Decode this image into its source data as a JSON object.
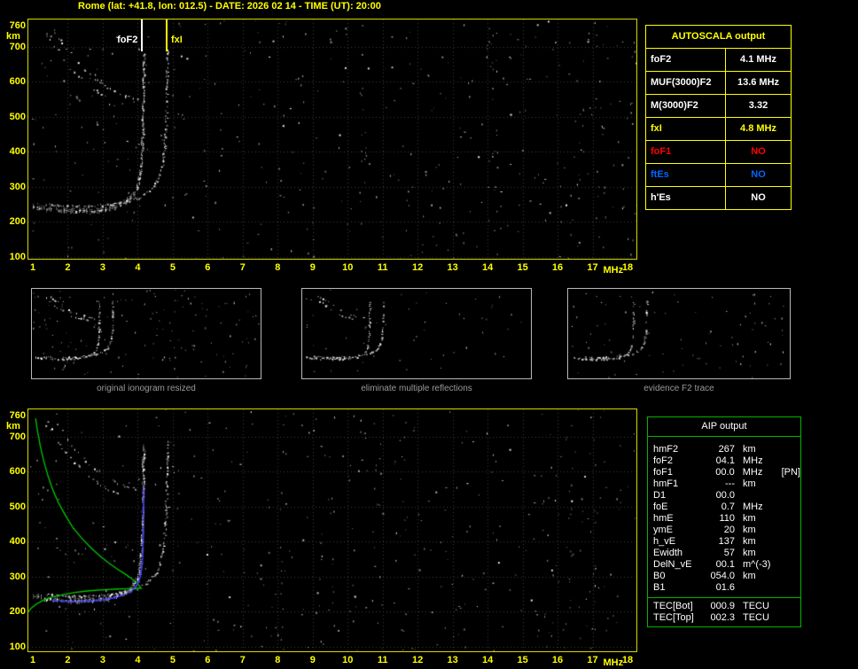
{
  "title": "Rome (lat: +41.8, lon: 012.5) - DATE: 2026 02 14 - TIME (UT): 20:00",
  "ionogram": {
    "x_ticks": [
      "1",
      "2",
      "3",
      "4",
      "5",
      "6",
      "7",
      "8",
      "9",
      "10",
      "11",
      "12",
      "13",
      "14",
      "15",
      "16",
      "17",
      "18"
    ],
    "x_unit": "MHz",
    "y_ticks": [
      "760",
      "700",
      "600",
      "500",
      "400",
      "300",
      "200",
      "100"
    ],
    "y_unit": "km",
    "markers": [
      {
        "label": "foF2",
        "mhz": 4.1,
        "color": "#ffffff"
      },
      {
        "label": "fxI",
        "mhz": 4.8,
        "color": "#ffff00"
      }
    ]
  },
  "autoscala_table": {
    "title": "AUTOSCALA output",
    "rows": [
      {
        "label": "foF2",
        "value": "4.1 MHz",
        "color": "#ffffff"
      },
      {
        "label": "MUF(3000)F2",
        "value": "13.6 MHz",
        "color": "#ffffff"
      },
      {
        "label": "M(3000)F2",
        "value": "3.32",
        "color": "#ffffff"
      },
      {
        "label": "fxI",
        "value": "4.8 MHz",
        "color": "#ffff00"
      },
      {
        "label": "foF1",
        "value": "NO",
        "color": "#ff0000"
      },
      {
        "label": "ftEs",
        "value": "NO",
        "color": "#0066ff"
      },
      {
        "label": "h'Es",
        "value": "NO",
        "color": "#ffffff"
      }
    ]
  },
  "thumbnails": [
    {
      "caption": "original ionogram resized"
    },
    {
      "caption": "eliminate multiple reflections"
    },
    {
      "caption": "evidence F2 trace"
    }
  ],
  "aip_table": {
    "title": "AIP output",
    "rows": [
      {
        "label": "hmF2",
        "value": "267",
        "unit": "km",
        "note": ""
      },
      {
        "label": "foF2",
        "value": "04.1",
        "unit": "MHz",
        "note": ""
      },
      {
        "label": "foF1",
        "value": "00.0",
        "unit": "MHz",
        "note": "[PN]"
      },
      {
        "label": "hmF1",
        "value": "---",
        "unit": "km",
        "note": ""
      },
      {
        "label": "D1",
        "value": "00.0",
        "unit": "",
        "note": ""
      },
      {
        "label": "foE",
        "value": "0.7",
        "unit": "MHz",
        "note": ""
      },
      {
        "label": "hmE",
        "value": "110",
        "unit": "km",
        "note": ""
      },
      {
        "label": "ymE",
        "value": "20",
        "unit": "km",
        "note": ""
      },
      {
        "label": "h_vE",
        "value": "137",
        "unit": "km",
        "note": ""
      },
      {
        "label": "Ewidth",
        "value": "57",
        "unit": "km",
        "note": ""
      },
      {
        "label": "DelN_vE",
        "value": "00.1",
        "unit": "m^(-3)",
        "note": ""
      },
      {
        "label": "B0",
        "value": "054.0",
        "unit": "km",
        "note": ""
      },
      {
        "label": "B1",
        "value": "01.6",
        "unit": "",
        "note": ""
      }
    ],
    "tec_rows": [
      {
        "label": "TEC[Bot]",
        "value": "000.9",
        "unit": "TECU"
      },
      {
        "label": "TEC[Top]",
        "value": "002.3",
        "unit": "TECU"
      }
    ]
  },
  "chart_data": [
    {
      "type": "scatter",
      "title": "Ionogram with AUTOSCALA scaled characteristics",
      "xlabel": "MHz",
      "ylabel": "km",
      "xlim": [
        1,
        18
      ],
      "ylim": [
        100,
        760
      ],
      "annotations": [
        {
          "label": "foF2",
          "x_mhz": 4.1
        },
        {
          "label": "fxI",
          "x_mhz": 4.8
        }
      ],
      "series": [
        {
          "name": "F2 ordinary trace",
          "color": "#ffffff",
          "points": [
            [
              1.0,
              248
            ],
            [
              1.15,
              244
            ],
            [
              1.3,
              241
            ],
            [
              1.5,
              238
            ],
            [
              1.7,
              236
            ],
            [
              1.9,
              234
            ],
            [
              2.1,
              233
            ],
            [
              2.3,
              233
            ],
            [
              2.5,
              233
            ],
            [
              2.7,
              234
            ],
            [
              2.9,
              236
            ],
            [
              3.1,
              239
            ],
            [
              3.3,
              244
            ],
            [
              3.5,
              251
            ],
            [
              3.65,
              259
            ],
            [
              3.8,
              270
            ],
            [
              3.9,
              283
            ],
            [
              3.97,
              297
            ],
            [
              4.02,
              315
            ],
            [
              4.06,
              338
            ],
            [
              4.09,
              368
            ],
            [
              4.11,
              405
            ],
            [
              4.13,
              455
            ],
            [
              4.14,
              520
            ],
            [
              4.15,
              600
            ],
            [
              4.16,
              680
            ]
          ]
        },
        {
          "name": "F2 extraordinary trace",
          "color": "#ffffff",
          "points": [
            [
              1.4,
              252
            ],
            [
              1.7,
              249
            ],
            [
              2.0,
              247
            ],
            [
              2.3,
              246
            ],
            [
              2.6,
              246
            ],
            [
              2.9,
              248
            ],
            [
              3.2,
              251
            ],
            [
              3.5,
              256
            ],
            [
              3.8,
              263
            ],
            [
              4.0,
              270
            ],
            [
              4.2,
              280
            ],
            [
              4.35,
              292
            ],
            [
              4.5,
              310
            ],
            [
              4.6,
              332
            ],
            [
              4.68,
              360
            ],
            [
              4.74,
              398
            ],
            [
              4.78,
              448
            ],
            [
              4.81,
              515
            ],
            [
              4.83,
              600
            ],
            [
              4.84,
              690
            ]
          ]
        },
        {
          "name": "low-frequency retardation arc 1",
          "color": "#ffffff",
          "points": [
            [
              1.35,
              750
            ],
            [
              1.5,
              722
            ],
            [
              1.7,
              690
            ],
            [
              1.95,
              655
            ],
            [
              2.2,
              625
            ],
            [
              2.5,
              597
            ],
            [
              2.8,
              574
            ],
            [
              3.1,
              556
            ],
            [
              3.4,
              543
            ],
            [
              3.7,
              535
            ]
          ]
        },
        {
          "name": "low-frequency retardation arc 2",
          "color": "#ffffff",
          "points": [
            [
              1.6,
              752
            ],
            [
              1.75,
              726
            ],
            [
              1.95,
              696
            ],
            [
              2.2,
              664
            ],
            [
              2.45,
              636
            ],
            [
              2.75,
              610
            ],
            [
              3.05,
              589
            ],
            [
              3.35,
              572
            ],
            [
              3.65,
              560
            ],
            [
              3.95,
              552
            ]
          ]
        }
      ]
    },
    {
      "type": "scatter",
      "title": "Ionogram with AIP restored electron density profile",
      "xlabel": "MHz",
      "ylabel": "km",
      "xlim": [
        1,
        18
      ],
      "ylim": [
        100,
        760
      ],
      "series": [
        {
          "name": "electron density profile (plasma frequency vs height)",
          "color": "#00c800",
          "points": [
            [
              0.87,
              200
            ],
            [
              0.95,
              210
            ],
            [
              1.1,
              222
            ],
            [
              1.3,
              233
            ],
            [
              1.55,
              242
            ],
            [
              1.85,
              249
            ],
            [
              2.2,
              255
            ],
            [
              2.6,
              260
            ],
            [
              3.0,
              263
            ],
            [
              3.4,
              265
            ],
            [
              3.75,
              266
            ],
            [
              4.1,
              267
            ],
            [
              4.0,
              280
            ],
            [
              3.85,
              293
            ],
            [
              3.65,
              307
            ],
            [
              3.4,
              323
            ],
            [
              3.15,
              341
            ],
            [
              2.9,
              361
            ],
            [
              2.65,
              384
            ],
            [
              2.4,
              410
            ],
            [
              2.15,
              440
            ],
            [
              1.95,
              472
            ],
            [
              1.75,
              508
            ],
            [
              1.58,
              546
            ],
            [
              1.44,
              586
            ],
            [
              1.32,
              628
            ],
            [
              1.22,
              670
            ],
            [
              1.14,
              712
            ],
            [
              1.08,
              752
            ]
          ]
        },
        {
          "name": "fitted ordinary trace",
          "color": "#4a4aff",
          "points": [
            [
              1.55,
              234
            ],
            [
              1.8,
              233
            ],
            [
              2.05,
              232
            ],
            [
              2.3,
              232
            ],
            [
              2.55,
              233
            ],
            [
              2.8,
              235
            ],
            [
              3.05,
              238
            ],
            [
              3.3,
              243
            ],
            [
              3.55,
              250
            ],
            [
              3.75,
              259
            ],
            [
              3.9,
              272
            ],
            [
              4.0,
              288
            ],
            [
              4.06,
              310
            ],
            [
              4.1,
              340
            ],
            [
              4.12,
              380
            ],
            [
              4.13,
              430
            ],
            [
              4.14,
              490
            ],
            [
              4.15,
              560
            ]
          ]
        }
      ]
    }
  ]
}
